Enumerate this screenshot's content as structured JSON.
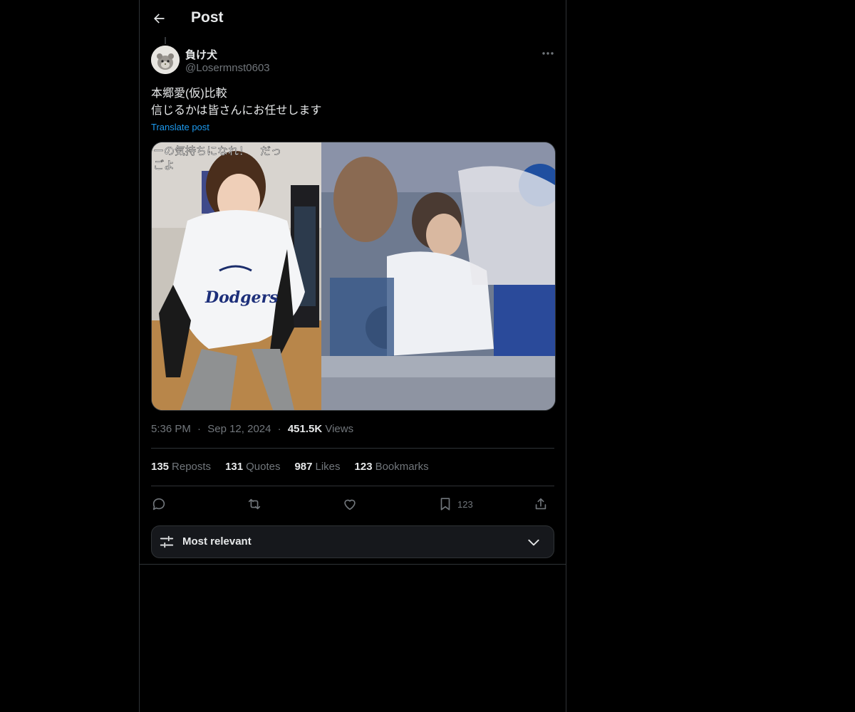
{
  "header": {
    "title": "Post",
    "back_icon": "arrow-left-icon"
  },
  "author": {
    "display_name": "負け犬",
    "handle": "@Losermnst0603",
    "avatar_icon": "hamster-avatar"
  },
  "post": {
    "lines": [
      "本郷愛(仮)比較",
      "信じるかは皆さんにお任せします"
    ],
    "translate_label": "Translate post",
    "media_overlay_text": "ーの気持ちになれ！　だっ",
    "media_overlay_text2": "ごよ",
    "jersey_text": "Dodgers"
  },
  "meta": {
    "time": "5:36 PM",
    "separator": "·",
    "date": "Sep 12, 2024",
    "views_count": "451.5K",
    "views_label": "Views"
  },
  "stats": [
    {
      "count": "135",
      "label": "Reposts"
    },
    {
      "count": "131",
      "label": "Quotes"
    },
    {
      "count": "987",
      "label": "Likes"
    },
    {
      "count": "123",
      "label": "Bookmarks"
    }
  ],
  "actions": {
    "bookmark_count": "123"
  },
  "sort": {
    "label": "Most relevant"
  },
  "colors": {
    "background": "#000000",
    "text": "#e7e9ea",
    "muted": "#71767b",
    "accent": "#1d9bf0",
    "border": "#2f3336"
  }
}
